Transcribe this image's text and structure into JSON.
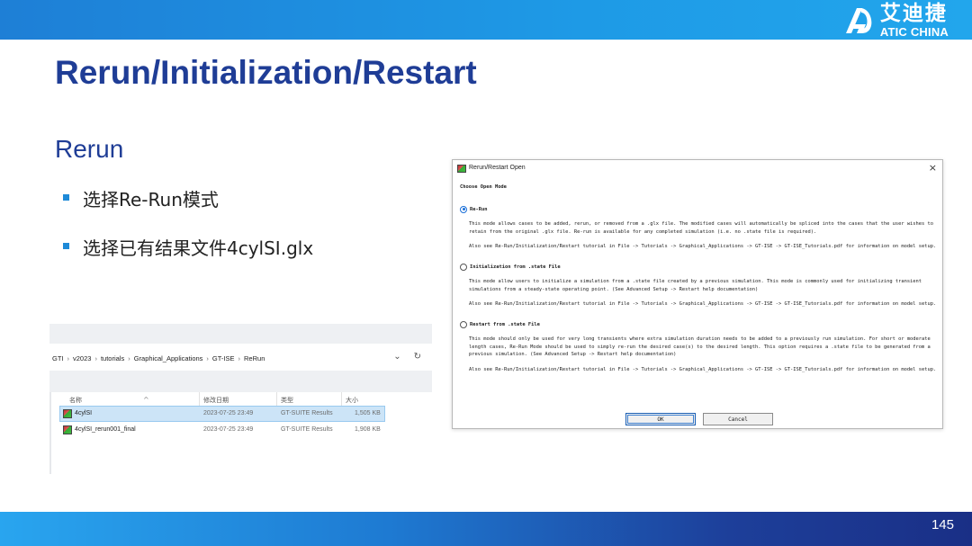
{
  "brand": {
    "name_cn": "艾迪捷",
    "name_en": "ATIC CHINA"
  },
  "slide": {
    "title": "Rerun/Initialization/Restart",
    "section": "Rerun",
    "page_number": "145"
  },
  "bullets": [
    "选择Re-Run模式",
    "选择已有结果文件4cylSI.glx"
  ],
  "explorer": {
    "breadcrumb": [
      "GTI",
      "v2023",
      "tutorials",
      "Graphical_Applications",
      "GT-ISE",
      "ReRun"
    ],
    "columns": [
      "名称",
      "修改日期",
      "类型",
      "大小"
    ],
    "rows": [
      {
        "name": "4cylSI",
        "date": "2023-07-25 23:49",
        "type": "GT-SUITE Results",
        "size": "1,505 KB",
        "selected": true
      },
      {
        "name": "4cylSI_rerun001_final",
        "date": "2023-07-25 23:49",
        "type": "GT-SUITE Results",
        "size": "1,908 KB",
        "selected": false
      }
    ]
  },
  "dialog": {
    "title": "Rerun/Restart Open",
    "mode_heading": "Choose Open Mode",
    "options": [
      {
        "label": "Re-Run",
        "selected": true,
        "description": "This mode allows cases to be added, rerun, or removed from a .glx file. The modified cases will automatically be spliced into the cases that the user wishes to retain from the original .glx file. Re-run is available for any completed simulation (i.e. no .state file is required).",
        "see_also": "Also see Re-Run/Initialization/Restart tutorial in File -> Tutorials -> Graphical_Applications -> GT-ISE -> GT-ISE_Tutorials.pdf for information on model setup."
      },
      {
        "label": "Initialization from .state File",
        "selected": false,
        "description": "This mode allow users to initialize a simulation from a .state file created by a previous simulation. This mode is commonly used for initializing transient simulations from a steady-state operating point. (See Advanced Setup -> Restart help documentation)",
        "see_also": "Also see Re-Run/Initialization/Restart tutorial in File -> Tutorials -> Graphical_Applications -> GT-ISE -> GT-ISE_Tutorials.pdf for information on model setup."
      },
      {
        "label": "Restart from .state File",
        "selected": false,
        "description": "This mode should only be used for very long transients where extra simulation duration needs to be added to a previously run simulation. For short or moderate length cases, Re-Run Mode should be used to simply re-run the desired case(s) to the desired length. This option requires a .state file to be generated from a previous simulation. (See Advanced Setup -> Restart help documentation)",
        "see_also": "Also see Re-Run/Initialization/Restart tutorial in File -> Tutorials -> Graphical_Applications -> GT-ISE -> GT-ISE_Tutorials.pdf for information on model setup."
      }
    ],
    "ok_label": "OK",
    "cancel_label": "Cancel",
    "close_glyph": "×"
  },
  "colors": {
    "accent": "#1f3d96",
    "topbar": "#1e8ad8",
    "bullet": "#1e8ad8"
  }
}
